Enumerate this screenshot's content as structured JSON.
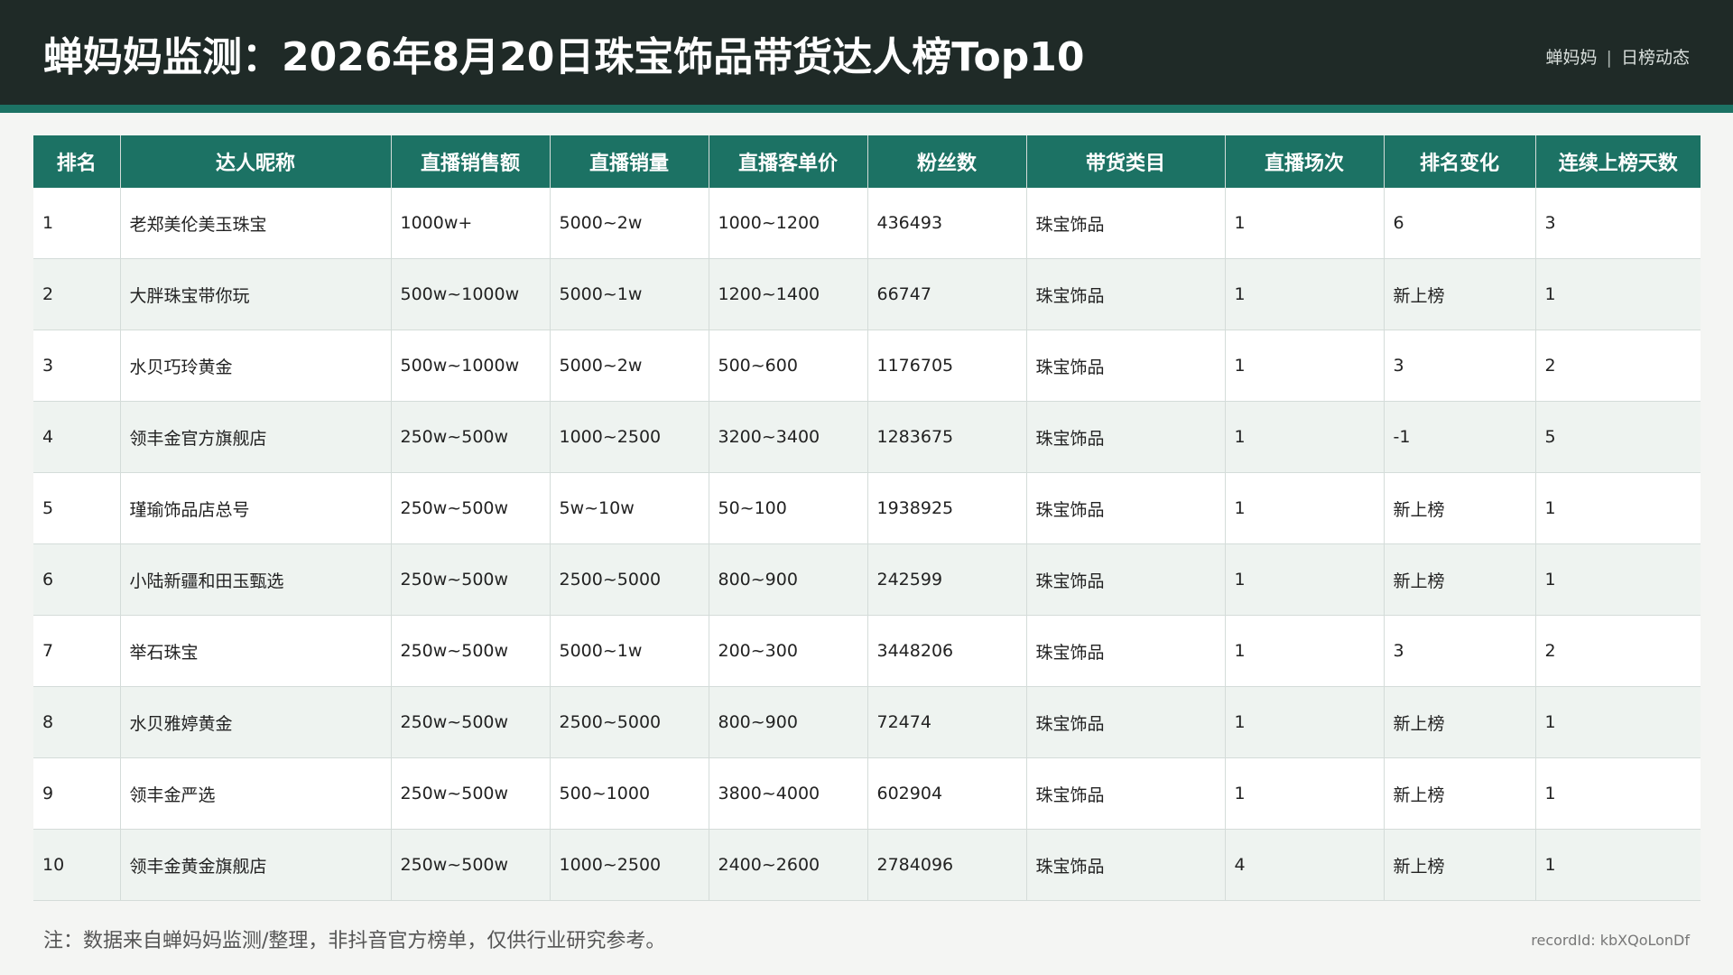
{
  "header": {
    "title": "蝉妈妈监测：2026年8月20日珠宝饰品带货达人榜Top10",
    "brand": "蝉妈妈",
    "brand_separator": "|",
    "section": "日榜动态"
  },
  "colors": {
    "header_bg": "#1f2a27",
    "accent": "#1c7264",
    "row_alt": "#eef3f0"
  },
  "table": {
    "columns": [
      "排名",
      "达人昵称",
      "直播销售额",
      "直播销量",
      "直播客单价",
      "粉丝数",
      "带货类目",
      "直播场次",
      "排名变化",
      "连续上榜天数"
    ],
    "rows": [
      [
        "1",
        "老郑美伦美玉珠宝",
        "1000w+",
        "5000~2w",
        "1000~1200",
        "436493",
        "珠宝饰品",
        "1",
        "6",
        "3"
      ],
      [
        "2",
        "大胖珠宝带你玩",
        "500w~1000w",
        "5000~1w",
        "1200~1400",
        "66747",
        "珠宝饰品",
        "1",
        "新上榜",
        "1"
      ],
      [
        "3",
        "水贝巧玲黄金",
        "500w~1000w",
        "5000~2w",
        "500~600",
        "1176705",
        "珠宝饰品",
        "1",
        "3",
        "2"
      ],
      [
        "4",
        "领丰金官方旗舰店",
        "250w~500w",
        "1000~2500",
        "3200~3400",
        "1283675",
        "珠宝饰品",
        "1",
        "-1",
        "5"
      ],
      [
        "5",
        "瑾瑜饰品店总号",
        "250w~500w",
        "5w~10w",
        "50~100",
        "1938925",
        "珠宝饰品",
        "1",
        "新上榜",
        "1"
      ],
      [
        "6",
        "小陆新疆和田玉甄选",
        "250w~500w",
        "2500~5000",
        "800~900",
        "242599",
        "珠宝饰品",
        "1",
        "新上榜",
        "1"
      ],
      [
        "7",
        "举石珠宝",
        "250w~500w",
        "5000~1w",
        "200~300",
        "3448206",
        "珠宝饰品",
        "1",
        "3",
        "2"
      ],
      [
        "8",
        "水贝雅婷黄金",
        "250w~500w",
        "2500~5000",
        "800~900",
        "72474",
        "珠宝饰品",
        "1",
        "新上榜",
        "1"
      ],
      [
        "9",
        "领丰金严选",
        "250w~500w",
        "500~1000",
        "3800~4000",
        "602904",
        "珠宝饰品",
        "1",
        "新上榜",
        "1"
      ],
      [
        "10",
        "领丰金黄金旗舰店",
        "250w~500w",
        "1000~2500",
        "2400~2600",
        "2784096",
        "珠宝饰品",
        "4",
        "新上榜",
        "1"
      ]
    ]
  },
  "footer": {
    "note": "注：数据来自蝉妈妈监测/整理，非抖音官方榜单，仅供行业研究参考。",
    "record_id": "recordId: kbXQoLonDf"
  }
}
